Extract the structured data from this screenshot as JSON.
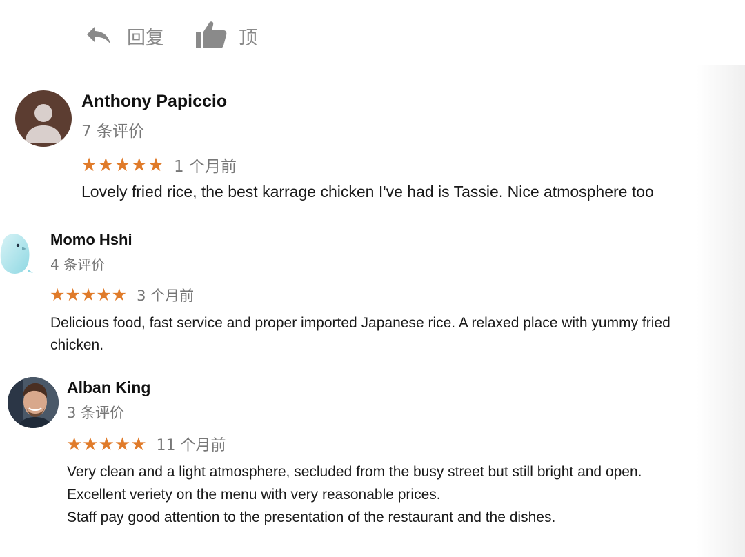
{
  "actions": {
    "reply_label": "回复",
    "top_label": "顶"
  },
  "reviews": [
    {
      "name": "Anthony Papiccio",
      "count": "7 条评价",
      "stars": "★★★★★",
      "time": "1 个月前",
      "text_lines": [
        "Lovely fried rice, the best karrage chicken I've had is Tassie. Nice atmosphere too"
      ],
      "avatar": "default-user-avatar"
    },
    {
      "name": "Momo Hshi",
      "count": "4 条评价",
      "stars": "★★★★★",
      "time": "3 个月前",
      "text_lines": [
        "Delicious food, fast service and proper imported Japanese rice. A relaxed place with yummy fried",
        "chicken."
      ],
      "avatar": "bird-avatar"
    },
    {
      "name": "Alban King",
      "count": "3 条评价",
      "stars": "★★★★★",
      "time": "11 个月前",
      "text_lines": [
        "Very clean and a light atmosphere, secluded from the busy street but still bright and open.",
        "Excellent veriety on the menu with very reasonable prices.",
        "Staff pay good attention to the presentation of the restaurant and the dishes."
      ],
      "avatar": "photo-avatar"
    }
  ],
  "colors": {
    "star": "#e07b2a",
    "muted": "#777777",
    "avatar_default_bg": "#5c3d31"
  }
}
